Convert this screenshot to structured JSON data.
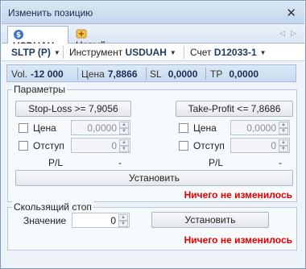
{
  "window": {
    "title": "Изменить позицию"
  },
  "tabs": [
    {
      "label": "USDUAH"
    },
    {
      "label": "Новый"
    }
  ],
  "toolbar": {
    "mode": "SLTP (P)",
    "instrument_label": "Инструмент",
    "instrument_value": "USDUAH",
    "account_label": "Счет",
    "account_value": "D12033-1"
  },
  "info": {
    "vol_label": "Vol.",
    "vol_value": "-12 000",
    "price_label": "Цена",
    "price_value": "7,8866",
    "sl_label": "SL",
    "sl_value": "0,0000",
    "tp_label": "TP",
    "tp_value": "0,0000"
  },
  "params": {
    "title": "Параметры",
    "stop_loss_button": "Stop-Loss >= 7,9056",
    "take_profit_button": "Take-Profit <= 7,8686",
    "left": {
      "price_label": "Цена",
      "price_value": "0,0000",
      "offset_label": "Отступ",
      "offset_value": "0",
      "pl_label": "P/L",
      "pl_value": "-"
    },
    "right": {
      "price_label": "Цена",
      "price_value": "0,0000",
      "offset_label": "Отступ",
      "offset_value": "0",
      "pl_label": "P/L",
      "pl_value": "-"
    },
    "set_button": "Установить",
    "status": "Ничего не изменилось"
  },
  "trailing": {
    "title": "Скользящий стоп",
    "value_label": "Значение",
    "value": "0",
    "set_button": "Установить",
    "status": "Ничего не изменилось"
  },
  "colors": {
    "status": "#e00000",
    "accent": "#1f3a5e"
  }
}
